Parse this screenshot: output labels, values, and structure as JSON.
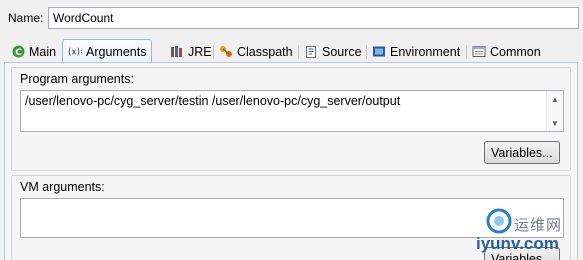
{
  "name_row": {
    "label": "Name:",
    "value": "WordCount"
  },
  "tabs": [
    {
      "label": "Main",
      "icon": "main-c-icon",
      "active": false
    },
    {
      "label": "Arguments",
      "icon": "arguments-x-icon",
      "active": true
    },
    {
      "label": "JRE",
      "icon": "jre-books-icon",
      "active": false
    },
    {
      "label": "Classpath",
      "icon": "classpath-icon",
      "active": false
    },
    {
      "label": "Source",
      "icon": "source-icon",
      "active": false
    },
    {
      "label": "Environment",
      "icon": "environment-icon",
      "active": false
    },
    {
      "label": "Common",
      "icon": "common-icon",
      "active": false
    }
  ],
  "program_arguments": {
    "title": "Program arguments:",
    "value": "/user/lenovo-pc/cyg_server/testin  /user/lenovo-pc/cyg_server/output",
    "button": "Variables..."
  },
  "vm_arguments": {
    "title": "VM arguments:",
    "value": "",
    "button": "Variables..."
  },
  "watermark": {
    "cn": "运维网",
    "url": "iyunv.com"
  },
  "colors": {
    "tab_active_border": "#9db6d3",
    "main_icon": "#3a9a3a",
    "watermark_blue": "#2a5f9e"
  }
}
